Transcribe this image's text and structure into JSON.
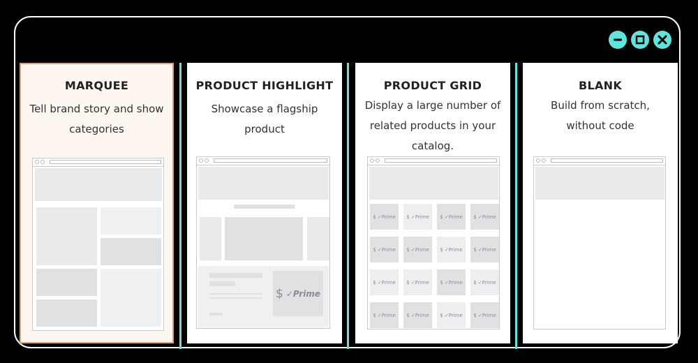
{
  "window": {
    "controls": [
      {
        "name": "minimize",
        "icon": "minimize-icon"
      },
      {
        "name": "maximize",
        "icon": "maximize-icon"
      },
      {
        "name": "close",
        "icon": "close-icon"
      }
    ]
  },
  "colors": {
    "accent": "#5ee6dc",
    "selected_bg": "#fdf6f1",
    "selected_border": "#d9a07a",
    "placeholder": "#e9eaeb"
  },
  "templates": [
    {
      "id": "marquee",
      "title": "MARQUEE",
      "description": "Tell brand story and show categories",
      "selected": true
    },
    {
      "id": "product-highlight",
      "title": "PRODUCT HIGHLIGHT",
      "description": "Showcase a flagship product",
      "selected": false,
      "badge": {
        "currency": "$",
        "label": "✓Prime"
      }
    },
    {
      "id": "product-grid",
      "title": "PRODUCT GRID",
      "description": "Display a large number of related products in your catalog.",
      "selected": false,
      "tile_label": "$ ✓Prime"
    },
    {
      "id": "blank",
      "title": "BLANK",
      "description": "Build from scratch, without code",
      "selected": false
    }
  ]
}
